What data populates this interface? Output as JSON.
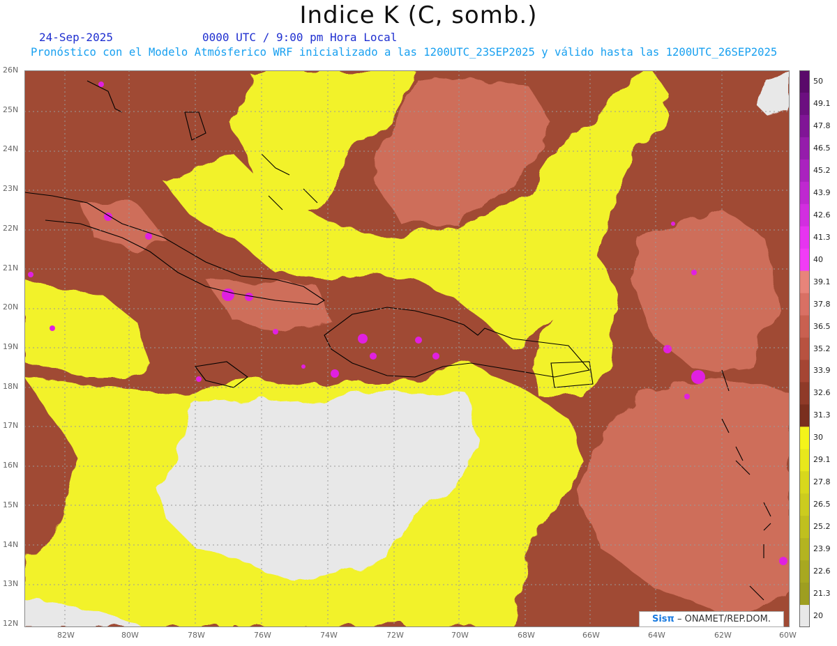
{
  "header": {
    "title": "Indice K (C, somb.)",
    "date": "24-Sep-2025",
    "valid_time": "0000 UTC / 9:00 pm Hora Local",
    "description": "Pronóstico con el Modelo Atmósferico WRF inicializado a las 1200UTC_23SEP2025 y válido hasta las  1200UTC_26SEP2025"
  },
  "map": {
    "lat_labels": [
      "26N",
      "25N",
      "24N",
      "23N",
      "22N",
      "21N",
      "20N",
      "19N",
      "18N",
      "17N",
      "16N",
      "15N",
      "14N",
      "13N",
      "12N"
    ],
    "lon_labels": [
      "82W",
      "80W",
      "78W",
      "76W",
      "74W",
      "72W",
      "70W",
      "68W",
      "66W",
      "64W",
      "62W",
      "60W"
    ],
    "colors": {
      "land_below_20": "#e8e8e8",
      "yellow_range": "#f2f22a",
      "brown_range": "#a04a34",
      "salmon_range": "#d4735e",
      "magenta_range": "#e020e0",
      "coastline": "#000000",
      "gridline": "#9a9a9a"
    }
  },
  "colorbar": {
    "labels": [
      "50",
      "49.1",
      "47.8",
      "46.5",
      "45.2",
      "43.9",
      "42.6",
      "41.3",
      "40",
      "39.1",
      "37.8",
      "36.5",
      "35.2",
      "33.9",
      "32.6",
      "31.3",
      "30",
      "29.1",
      "27.8",
      "26.5",
      "25.2",
      "23.9",
      "22.6",
      "21.3",
      "20"
    ],
    "colors": [
      "#5a0a6a",
      "#6c0f80",
      "#801596",
      "#951cab",
      "#aa22bf",
      "#bf28d0",
      "#d22ee0",
      "#e634f0",
      "#f23cf6",
      "#e8847a",
      "#d97064",
      "#c96050",
      "#b85240",
      "#a54533",
      "#8f3a28",
      "#7a2f1e",
      "#f4f41a",
      "#e8e81c",
      "#d8d81c",
      "#cccc1e",
      "#c0c01e",
      "#b4b420",
      "#a8a820",
      "#9e9e20",
      "#e8e8e8"
    ]
  },
  "credit": {
    "logo": "Sisπ",
    "text": "– ONAMET/REP.DOM."
  }
}
